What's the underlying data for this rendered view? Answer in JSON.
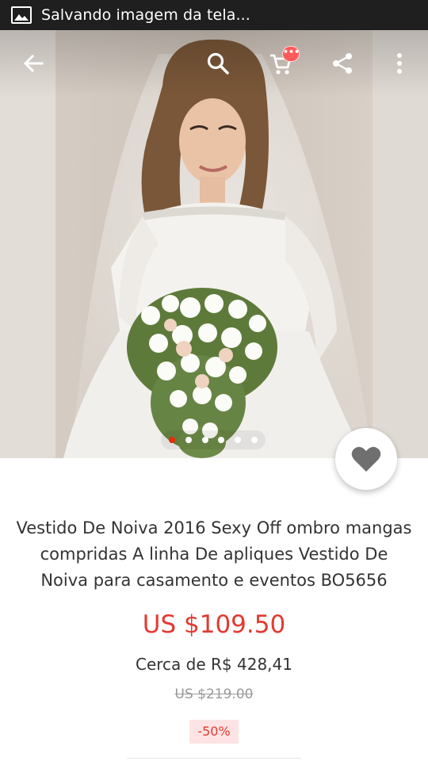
{
  "status_bar": {
    "notification_text": "Salvando imagem da tela..."
  },
  "icons": {
    "notification": "image-icon",
    "back": "arrow-left-icon",
    "search": "search-icon",
    "cart": "cart-icon",
    "share": "share-icon",
    "more": "more-vert-icon",
    "favorite": "heart-icon"
  },
  "toolbar": {
    "cart_badge": "•••"
  },
  "gallery": {
    "image_count": 6,
    "active_index": 0
  },
  "product": {
    "title": "Vestido De Noiva 2016 Sexy Off ombro mangas compridas A linha De apliques Vestido De Noiva para casamento e eventos BO5656",
    "price": "US $109.50",
    "approx_price": "Cerca de R$ 428,41",
    "original_price": "US $219.00",
    "discount": "-50%"
  },
  "colors": {
    "price": "#e23a30",
    "discount_bg": "#fde3e3",
    "active_dot": "#e62e04"
  }
}
